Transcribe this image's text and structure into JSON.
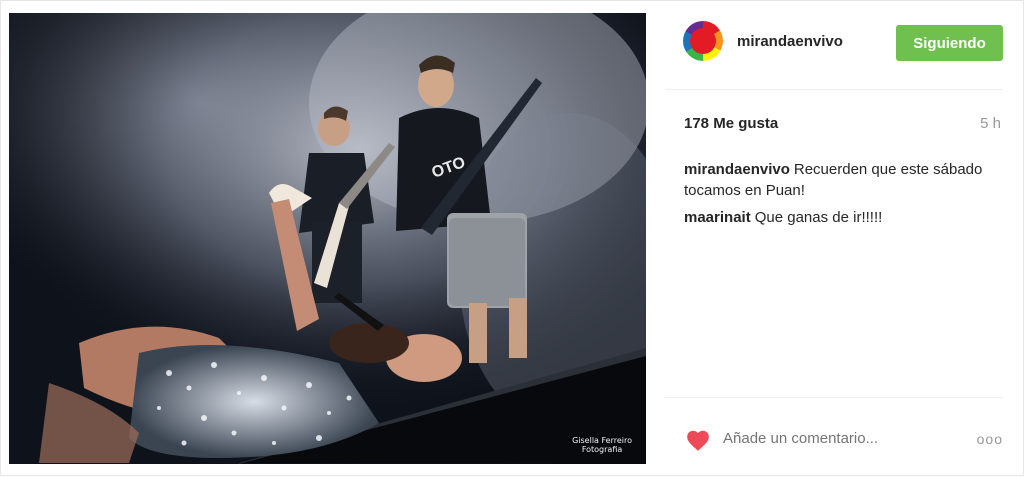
{
  "photo": {
    "credit_line1": "Gisella Ferreiro",
    "credit_line2": "Fotografia",
    "shirt_text": "OTO"
  },
  "post": {
    "username": "mirandaenvivo",
    "follow_label": "Siguiendo",
    "likes": "178 Me gusta",
    "time": "5 h",
    "comments": [
      {
        "user": "mirandaenvivo",
        "text": "Recuerden que este sábado tocamos en Puan!"
      },
      {
        "user": "maarinait",
        "text": "Que ganas de ir!!!!!"
      }
    ],
    "comment_placeholder": "Añade un comentario...",
    "more_label": "ooo"
  },
  "colors": {
    "follow_button": "#70c050",
    "heart": "#ed4956",
    "text_muted": "#999999"
  },
  "icons": {
    "heart": "heart-icon",
    "more": "more-options-icon"
  }
}
